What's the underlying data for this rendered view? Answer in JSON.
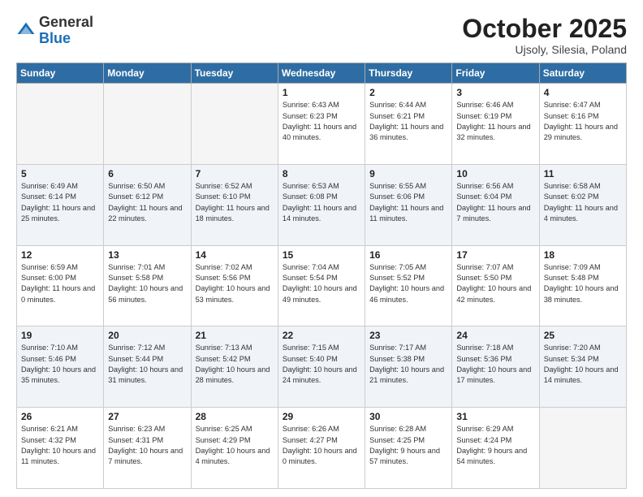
{
  "logo": {
    "general": "General",
    "blue": "Blue"
  },
  "title": "October 2025",
  "location": "Ujsoly, Silesia, Poland",
  "days_of_week": [
    "Sunday",
    "Monday",
    "Tuesday",
    "Wednesday",
    "Thursday",
    "Friday",
    "Saturday"
  ],
  "weeks": [
    [
      {
        "day": "",
        "info": ""
      },
      {
        "day": "",
        "info": ""
      },
      {
        "day": "",
        "info": ""
      },
      {
        "day": "1",
        "info": "Sunrise: 6:43 AM\nSunset: 6:23 PM\nDaylight: 11 hours\nand 40 minutes."
      },
      {
        "day": "2",
        "info": "Sunrise: 6:44 AM\nSunset: 6:21 PM\nDaylight: 11 hours\nand 36 minutes."
      },
      {
        "day": "3",
        "info": "Sunrise: 6:46 AM\nSunset: 6:19 PM\nDaylight: 11 hours\nand 32 minutes."
      },
      {
        "day": "4",
        "info": "Sunrise: 6:47 AM\nSunset: 6:16 PM\nDaylight: 11 hours\nand 29 minutes."
      }
    ],
    [
      {
        "day": "5",
        "info": "Sunrise: 6:49 AM\nSunset: 6:14 PM\nDaylight: 11 hours\nand 25 minutes."
      },
      {
        "day": "6",
        "info": "Sunrise: 6:50 AM\nSunset: 6:12 PM\nDaylight: 11 hours\nand 22 minutes."
      },
      {
        "day": "7",
        "info": "Sunrise: 6:52 AM\nSunset: 6:10 PM\nDaylight: 11 hours\nand 18 minutes."
      },
      {
        "day": "8",
        "info": "Sunrise: 6:53 AM\nSunset: 6:08 PM\nDaylight: 11 hours\nand 14 minutes."
      },
      {
        "day": "9",
        "info": "Sunrise: 6:55 AM\nSunset: 6:06 PM\nDaylight: 11 hours\nand 11 minutes."
      },
      {
        "day": "10",
        "info": "Sunrise: 6:56 AM\nSunset: 6:04 PM\nDaylight: 11 hours\nand 7 minutes."
      },
      {
        "day": "11",
        "info": "Sunrise: 6:58 AM\nSunset: 6:02 PM\nDaylight: 11 hours\nand 4 minutes."
      }
    ],
    [
      {
        "day": "12",
        "info": "Sunrise: 6:59 AM\nSunset: 6:00 PM\nDaylight: 11 hours\nand 0 minutes."
      },
      {
        "day": "13",
        "info": "Sunrise: 7:01 AM\nSunset: 5:58 PM\nDaylight: 10 hours\nand 56 minutes."
      },
      {
        "day": "14",
        "info": "Sunrise: 7:02 AM\nSunset: 5:56 PM\nDaylight: 10 hours\nand 53 minutes."
      },
      {
        "day": "15",
        "info": "Sunrise: 7:04 AM\nSunset: 5:54 PM\nDaylight: 10 hours\nand 49 minutes."
      },
      {
        "day": "16",
        "info": "Sunrise: 7:05 AM\nSunset: 5:52 PM\nDaylight: 10 hours\nand 46 minutes."
      },
      {
        "day": "17",
        "info": "Sunrise: 7:07 AM\nSunset: 5:50 PM\nDaylight: 10 hours\nand 42 minutes."
      },
      {
        "day": "18",
        "info": "Sunrise: 7:09 AM\nSunset: 5:48 PM\nDaylight: 10 hours\nand 38 minutes."
      }
    ],
    [
      {
        "day": "19",
        "info": "Sunrise: 7:10 AM\nSunset: 5:46 PM\nDaylight: 10 hours\nand 35 minutes."
      },
      {
        "day": "20",
        "info": "Sunrise: 7:12 AM\nSunset: 5:44 PM\nDaylight: 10 hours\nand 31 minutes."
      },
      {
        "day": "21",
        "info": "Sunrise: 7:13 AM\nSunset: 5:42 PM\nDaylight: 10 hours\nand 28 minutes."
      },
      {
        "day": "22",
        "info": "Sunrise: 7:15 AM\nSunset: 5:40 PM\nDaylight: 10 hours\nand 24 minutes."
      },
      {
        "day": "23",
        "info": "Sunrise: 7:17 AM\nSunset: 5:38 PM\nDaylight: 10 hours\nand 21 minutes."
      },
      {
        "day": "24",
        "info": "Sunrise: 7:18 AM\nSunset: 5:36 PM\nDaylight: 10 hours\nand 17 minutes."
      },
      {
        "day": "25",
        "info": "Sunrise: 7:20 AM\nSunset: 5:34 PM\nDaylight: 10 hours\nand 14 minutes."
      }
    ],
    [
      {
        "day": "26",
        "info": "Sunrise: 6:21 AM\nSunset: 4:32 PM\nDaylight: 10 hours\nand 11 minutes."
      },
      {
        "day": "27",
        "info": "Sunrise: 6:23 AM\nSunset: 4:31 PM\nDaylight: 10 hours\nand 7 minutes."
      },
      {
        "day": "28",
        "info": "Sunrise: 6:25 AM\nSunset: 4:29 PM\nDaylight: 10 hours\nand 4 minutes."
      },
      {
        "day": "29",
        "info": "Sunrise: 6:26 AM\nSunset: 4:27 PM\nDaylight: 10 hours\nand 0 minutes."
      },
      {
        "day": "30",
        "info": "Sunrise: 6:28 AM\nSunset: 4:25 PM\nDaylight: 9 hours\nand 57 minutes."
      },
      {
        "day": "31",
        "info": "Sunrise: 6:29 AM\nSunset: 4:24 PM\nDaylight: 9 hours\nand 54 minutes."
      },
      {
        "day": "",
        "info": ""
      }
    ]
  ]
}
